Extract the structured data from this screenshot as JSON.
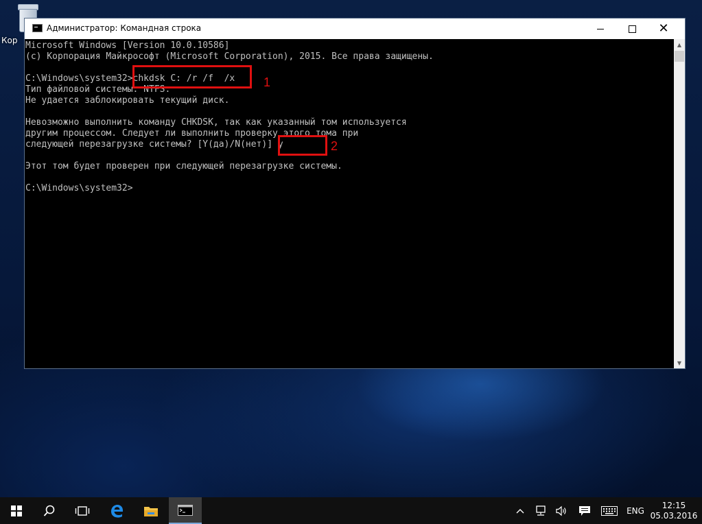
{
  "desktop": {
    "icon_label": "Кор"
  },
  "window": {
    "title": "Администратор: Командная строка",
    "controls": {
      "minimize": "–",
      "maximize": "□",
      "close": "✕"
    }
  },
  "console": {
    "lines": [
      "Microsoft Windows [Version 10.0.10586]",
      "(c) Корпорация Майкрософт (Microsoft Corporation), 2015. Все права защищены.",
      "",
      "C:\\Windows\\system32>chkdsk C: /r /f  /x",
      "Тип файловой системы: NTFS.",
      "Не удается заблокировать текущий диск.",
      "",
      "Невозможно выполнить команду CHKDSK, так как указанный том используется",
      "другим процессом. Следует ли выполнить проверку этого тома при",
      "следующей перезагрузке системы? [Y(да)/N(нет)] y",
      "",
      "Этот том будет проверен при следующей перезагрузке системы.",
      "",
      "C:\\Windows\\system32>"
    ]
  },
  "annotations": {
    "first": "1",
    "second": "2"
  },
  "taskbar": {
    "icons": [
      "windows-start-icon",
      "search-icon",
      "task-view-icon",
      "edge-icon",
      "file-explorer-icon",
      "command-prompt-icon"
    ],
    "tray_language": "ENG",
    "clock_time": "12:15",
    "clock_date": "05.03.2016"
  }
}
